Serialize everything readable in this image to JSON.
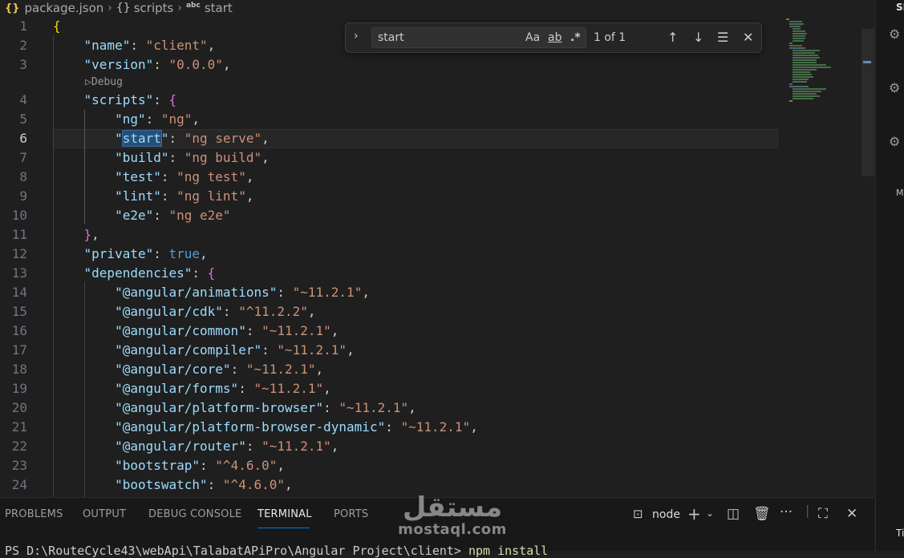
{
  "breadcrumb": {
    "file": "package.json",
    "file_icon": "{}",
    "section": "scripts",
    "section_icon": "{}",
    "item": "start",
    "item_icon": "abc"
  },
  "editor": {
    "codelens": "▷Debug",
    "lines": [
      {
        "n": "1",
        "tokens": [
          {
            "t": "{",
            "c": "b1"
          }
        ]
      },
      {
        "n": "2",
        "tokens": [
          {
            "t": "    ",
            "c": "p"
          },
          {
            "t": "\"name\"",
            "c": "k"
          },
          {
            "t": ": ",
            "c": "p"
          },
          {
            "t": "\"client\"",
            "c": "s"
          },
          {
            "t": ",",
            "c": "p"
          }
        ]
      },
      {
        "n": "3",
        "tokens": [
          {
            "t": "    ",
            "c": "p"
          },
          {
            "t": "\"version\"",
            "c": "k"
          },
          {
            "t": ": ",
            "c": "p"
          },
          {
            "t": "\"0.0.0\"",
            "c": "s"
          },
          {
            "t": ",",
            "c": "p"
          }
        ]
      },
      {
        "n": "4",
        "tokens": [
          {
            "t": "    ",
            "c": "p"
          },
          {
            "t": "\"scripts\"",
            "c": "k"
          },
          {
            "t": ": ",
            "c": "p"
          },
          {
            "t": "{",
            "c": "b2"
          }
        ]
      },
      {
        "n": "5",
        "tokens": [
          {
            "t": "        ",
            "c": "p"
          },
          {
            "t": "\"ng\"",
            "c": "k"
          },
          {
            "t": ": ",
            "c": "p"
          },
          {
            "t": "\"ng\"",
            "c": "s"
          },
          {
            "t": ",",
            "c": "p"
          }
        ]
      },
      {
        "n": "6",
        "tokens": [
          {
            "t": "        ",
            "c": "p"
          },
          {
            "t": "\"",
            "c": "q"
          },
          {
            "t": "start",
            "c": "k match"
          },
          {
            "t": "\"",
            "c": "q"
          },
          {
            "t": ": ",
            "c": "p"
          },
          {
            "t": "\"ng serve\"",
            "c": "s"
          },
          {
            "t": ",",
            "c": "p"
          }
        ]
      },
      {
        "n": "7",
        "tokens": [
          {
            "t": "        ",
            "c": "p"
          },
          {
            "t": "\"build\"",
            "c": "k"
          },
          {
            "t": ": ",
            "c": "p"
          },
          {
            "t": "\"ng build\"",
            "c": "s"
          },
          {
            "t": ",",
            "c": "p"
          }
        ]
      },
      {
        "n": "8",
        "tokens": [
          {
            "t": "        ",
            "c": "p"
          },
          {
            "t": "\"test\"",
            "c": "k"
          },
          {
            "t": ": ",
            "c": "p"
          },
          {
            "t": "\"ng test\"",
            "c": "s"
          },
          {
            "t": ",",
            "c": "p"
          }
        ]
      },
      {
        "n": "9",
        "tokens": [
          {
            "t": "        ",
            "c": "p"
          },
          {
            "t": "\"lint\"",
            "c": "k"
          },
          {
            "t": ": ",
            "c": "p"
          },
          {
            "t": "\"ng lint\"",
            "c": "s"
          },
          {
            "t": ",",
            "c": "p"
          }
        ]
      },
      {
        "n": "10",
        "tokens": [
          {
            "t": "        ",
            "c": "p"
          },
          {
            "t": "\"e2e\"",
            "c": "k"
          },
          {
            "t": ": ",
            "c": "p"
          },
          {
            "t": "\"ng e2e\"",
            "c": "s"
          }
        ]
      },
      {
        "n": "11",
        "tokens": [
          {
            "t": "    ",
            "c": "p"
          },
          {
            "t": "}",
            "c": "b2"
          },
          {
            "t": ",",
            "c": "p"
          }
        ]
      },
      {
        "n": "12",
        "tokens": [
          {
            "t": "    ",
            "c": "p"
          },
          {
            "t": "\"private\"",
            "c": "k"
          },
          {
            "t": ": ",
            "c": "p"
          },
          {
            "t": "true",
            "c": "bool"
          },
          {
            "t": ",",
            "c": "p"
          }
        ]
      },
      {
        "n": "13",
        "tokens": [
          {
            "t": "    ",
            "c": "p"
          },
          {
            "t": "\"dependencies\"",
            "c": "k"
          },
          {
            "t": ": ",
            "c": "p"
          },
          {
            "t": "{",
            "c": "b2"
          }
        ]
      },
      {
        "n": "14",
        "tokens": [
          {
            "t": "        ",
            "c": "p"
          },
          {
            "t": "\"@angular/animations\"",
            "c": "k"
          },
          {
            "t": ": ",
            "c": "p"
          },
          {
            "t": "\"~11.2.1\"",
            "c": "s"
          },
          {
            "t": ",",
            "c": "p"
          }
        ]
      },
      {
        "n": "15",
        "tokens": [
          {
            "t": "        ",
            "c": "p"
          },
          {
            "t": "\"@angular/cdk\"",
            "c": "k"
          },
          {
            "t": ": ",
            "c": "p"
          },
          {
            "t": "\"^11.2.2\"",
            "c": "s"
          },
          {
            "t": ",",
            "c": "p"
          }
        ]
      },
      {
        "n": "16",
        "tokens": [
          {
            "t": "        ",
            "c": "p"
          },
          {
            "t": "\"@angular/common\"",
            "c": "k"
          },
          {
            "t": ": ",
            "c": "p"
          },
          {
            "t": "\"~11.2.1\"",
            "c": "s"
          },
          {
            "t": ",",
            "c": "p"
          }
        ]
      },
      {
        "n": "17",
        "tokens": [
          {
            "t": "        ",
            "c": "p"
          },
          {
            "t": "\"@angular/compiler\"",
            "c": "k"
          },
          {
            "t": ": ",
            "c": "p"
          },
          {
            "t": "\"~11.2.1\"",
            "c": "s"
          },
          {
            "t": ",",
            "c": "p"
          }
        ]
      },
      {
        "n": "18",
        "tokens": [
          {
            "t": "        ",
            "c": "p"
          },
          {
            "t": "\"@angular/core\"",
            "c": "k"
          },
          {
            "t": ": ",
            "c": "p"
          },
          {
            "t": "\"~11.2.1\"",
            "c": "s"
          },
          {
            "t": ",",
            "c": "p"
          }
        ]
      },
      {
        "n": "19",
        "tokens": [
          {
            "t": "        ",
            "c": "p"
          },
          {
            "t": "\"@angular/forms\"",
            "c": "k"
          },
          {
            "t": ": ",
            "c": "p"
          },
          {
            "t": "\"~11.2.1\"",
            "c": "s"
          },
          {
            "t": ",",
            "c": "p"
          }
        ]
      },
      {
        "n": "20",
        "tokens": [
          {
            "t": "        ",
            "c": "p"
          },
          {
            "t": "\"@angular/platform-browser\"",
            "c": "k"
          },
          {
            "t": ": ",
            "c": "p"
          },
          {
            "t": "\"~11.2.1\"",
            "c": "s"
          },
          {
            "t": ",",
            "c": "p"
          }
        ]
      },
      {
        "n": "21",
        "tokens": [
          {
            "t": "        ",
            "c": "p"
          },
          {
            "t": "\"@angular/platform-browser-dynamic\"",
            "c": "k"
          },
          {
            "t": ": ",
            "c": "p"
          },
          {
            "t": "\"~11.2.1\"",
            "c": "s"
          },
          {
            "t": ",",
            "c": "p"
          }
        ]
      },
      {
        "n": "22",
        "tokens": [
          {
            "t": "        ",
            "c": "p"
          },
          {
            "t": "\"@angular/router\"",
            "c": "k"
          },
          {
            "t": ": ",
            "c": "p"
          },
          {
            "t": "\"~11.2.1\"",
            "c": "s"
          },
          {
            "t": ",",
            "c": "p"
          }
        ]
      },
      {
        "n": "23",
        "tokens": [
          {
            "t": "        ",
            "c": "p"
          },
          {
            "t": "\"bootstrap\"",
            "c": "k"
          },
          {
            "t": ": ",
            "c": "p"
          },
          {
            "t": "\"^4.6.0\"",
            "c": "s"
          },
          {
            "t": ",",
            "c": "p"
          }
        ]
      },
      {
        "n": "24",
        "tokens": [
          {
            "t": "        ",
            "c": "p"
          },
          {
            "t": "\"bootswatch\"",
            "c": "k"
          },
          {
            "t": ": ",
            "c": "p"
          },
          {
            "t": "\"^4.6.0\"",
            "c": "s"
          },
          {
            "t": ",",
            "c": "p"
          }
        ]
      }
    ],
    "active_line": "6"
  },
  "find": {
    "query": "start",
    "match_case_label": "Aa",
    "whole_word_label": "ab",
    "regex_label": ".*",
    "result_count": "1 of 1"
  },
  "panel": {
    "tabs": [
      "PROBLEMS",
      "OUTPUT",
      "DEBUG CONSOLE",
      "TERMINAL",
      "PORTS"
    ],
    "active_tab": "TERMINAL",
    "terminal_name": "node",
    "terminal_prompt": "PS D:\\RouteCycle43\\webApi\\TalabatAPiPro\\Angular Project\\client> ",
    "terminal_command": "npm install"
  },
  "right_panel": {
    "title": "SE",
    "letter": "M",
    "bottom_label": "Ti"
  },
  "watermark": {
    "arabic": "مستقل",
    "latin": "mostaql.com"
  }
}
